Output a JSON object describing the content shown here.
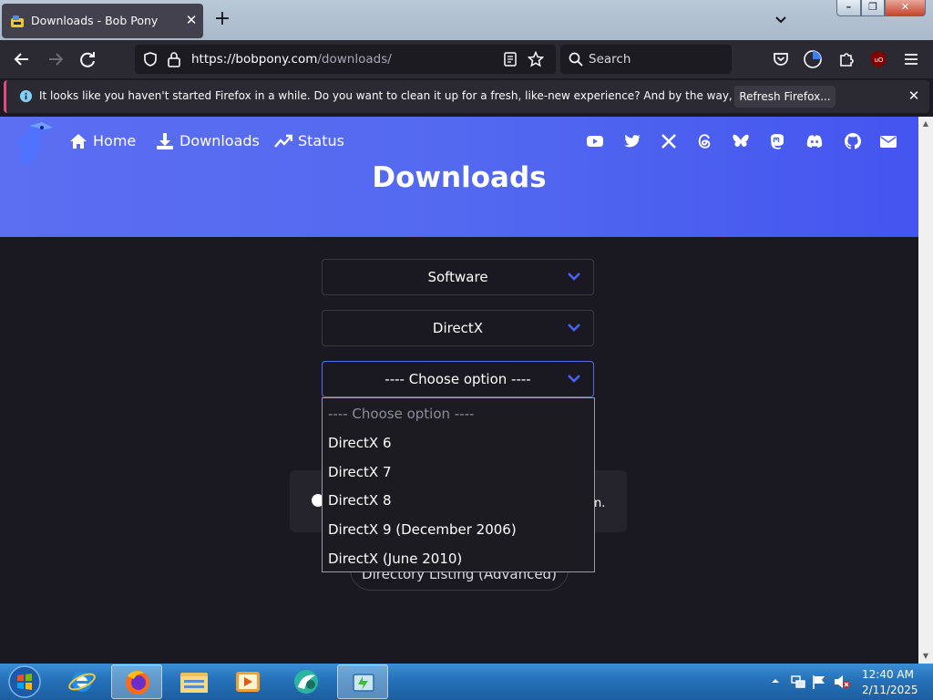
{
  "browser": {
    "tab_title": "Downloads - Bob Pony",
    "tab_close": "✕",
    "new_tab": "+",
    "url_host": "https://bobpony.com",
    "url_path": "/downloads/",
    "search_placeholder": "Search",
    "window_minimize": "–",
    "window_maximize": "❐",
    "window_close": "✕"
  },
  "notification": {
    "text": "It looks like you haven't started Firefox in a while. Do you want to clean it up for a fresh, like-new experience? And by the way, welcome back!",
    "button": "Refresh Firefox...",
    "close": "✕",
    "accent": "#e54b7e"
  },
  "site": {
    "nav": [
      {
        "label": "Home",
        "icon": "home-icon"
      },
      {
        "label": "Downloads",
        "icon": "download-icon"
      },
      {
        "label": "Status",
        "icon": "trending-icon"
      }
    ],
    "social_icons": [
      "youtube-icon",
      "twitter-icon",
      "x-icon",
      "threads-icon",
      "bluesky-icon",
      "mastodon-icon",
      "discord-icon",
      "github-icon",
      "email-icon"
    ],
    "title": "Downloads",
    "hero_color": "#5369f0"
  },
  "form": {
    "select1": "Software",
    "select2": "DirectX",
    "select3": "---- Choose option ----",
    "dropdown_options": [
      "---- Choose option ----",
      "DirectX 6",
      "DirectX 7",
      "DirectX 8",
      "DirectX 9 (December 2006)",
      "DirectX (June 2010)"
    ],
    "info_tail": "n.",
    "directory_button": "Directory Listing (Advanced)"
  },
  "taskbar": {
    "apps": [
      "internet-explorer-icon",
      "firefox-icon",
      "file-explorer-icon",
      "media-player-icon",
      "app-icon",
      "window-icon"
    ],
    "clock_time": "12:40 AM",
    "clock_date": "2/11/2025"
  }
}
